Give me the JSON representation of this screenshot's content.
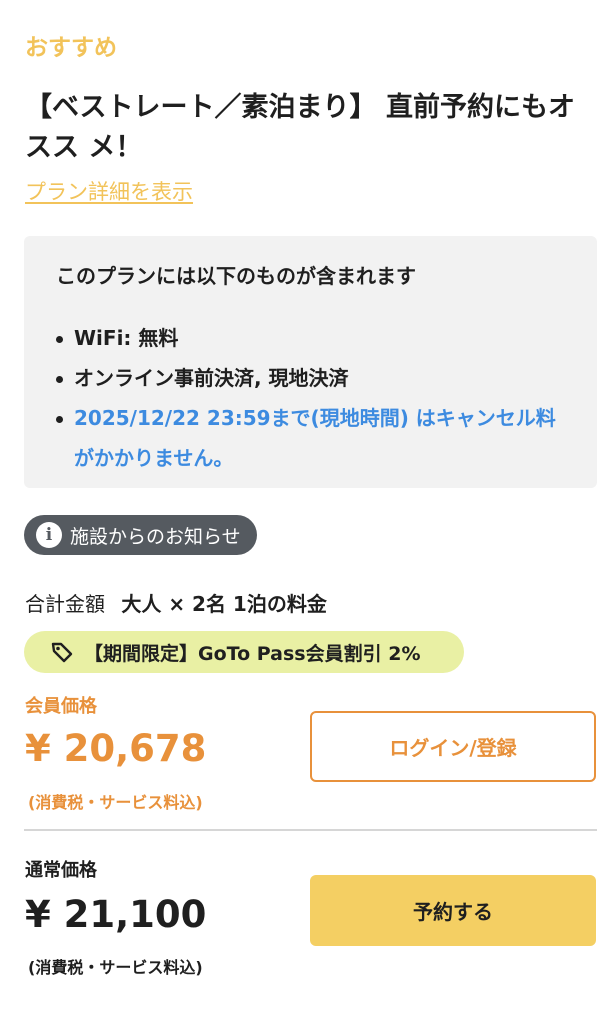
{
  "header": {
    "recommend_label": "おすすめ",
    "plan_title": "【ベストレート／素泊まり】 直前予約にもオスス メ！",
    "plan_detail_link": "プラン詳細を表示"
  },
  "includes": {
    "title": "このプランには以下のものが含まれます",
    "items": [
      "WiFi: 無料",
      "オンライン事前決済, 現地決済",
      "2025/12/22 23:59まで(現地時間) はキャンセル料がかかりません。"
    ]
  },
  "notice": {
    "label": "施設からのお知らせ",
    "icon": "info-icon"
  },
  "total": {
    "label": "合計金額",
    "value": "大人 × 2名 1泊の料金"
  },
  "discount": {
    "label": "【期間限定】GoTo Pass会員割引 2%",
    "icon": "tag-icon"
  },
  "member": {
    "label": "会員価格",
    "price": "¥ 20,678",
    "tax_note": "(消費税・サービス料込)",
    "button": "ログイン/登録"
  },
  "regular": {
    "label": "通常価格",
    "price": "¥ 21,100",
    "tax_note": "(消費税・サービス料込)",
    "button": "予約する"
  },
  "colors": {
    "accent_yellow": "#f2c35a",
    "member_orange": "#e8913b",
    "cancel_blue": "#3d8be0",
    "discount_bg": "#e9f0a4",
    "reserve_btn": "#f4cf63"
  }
}
